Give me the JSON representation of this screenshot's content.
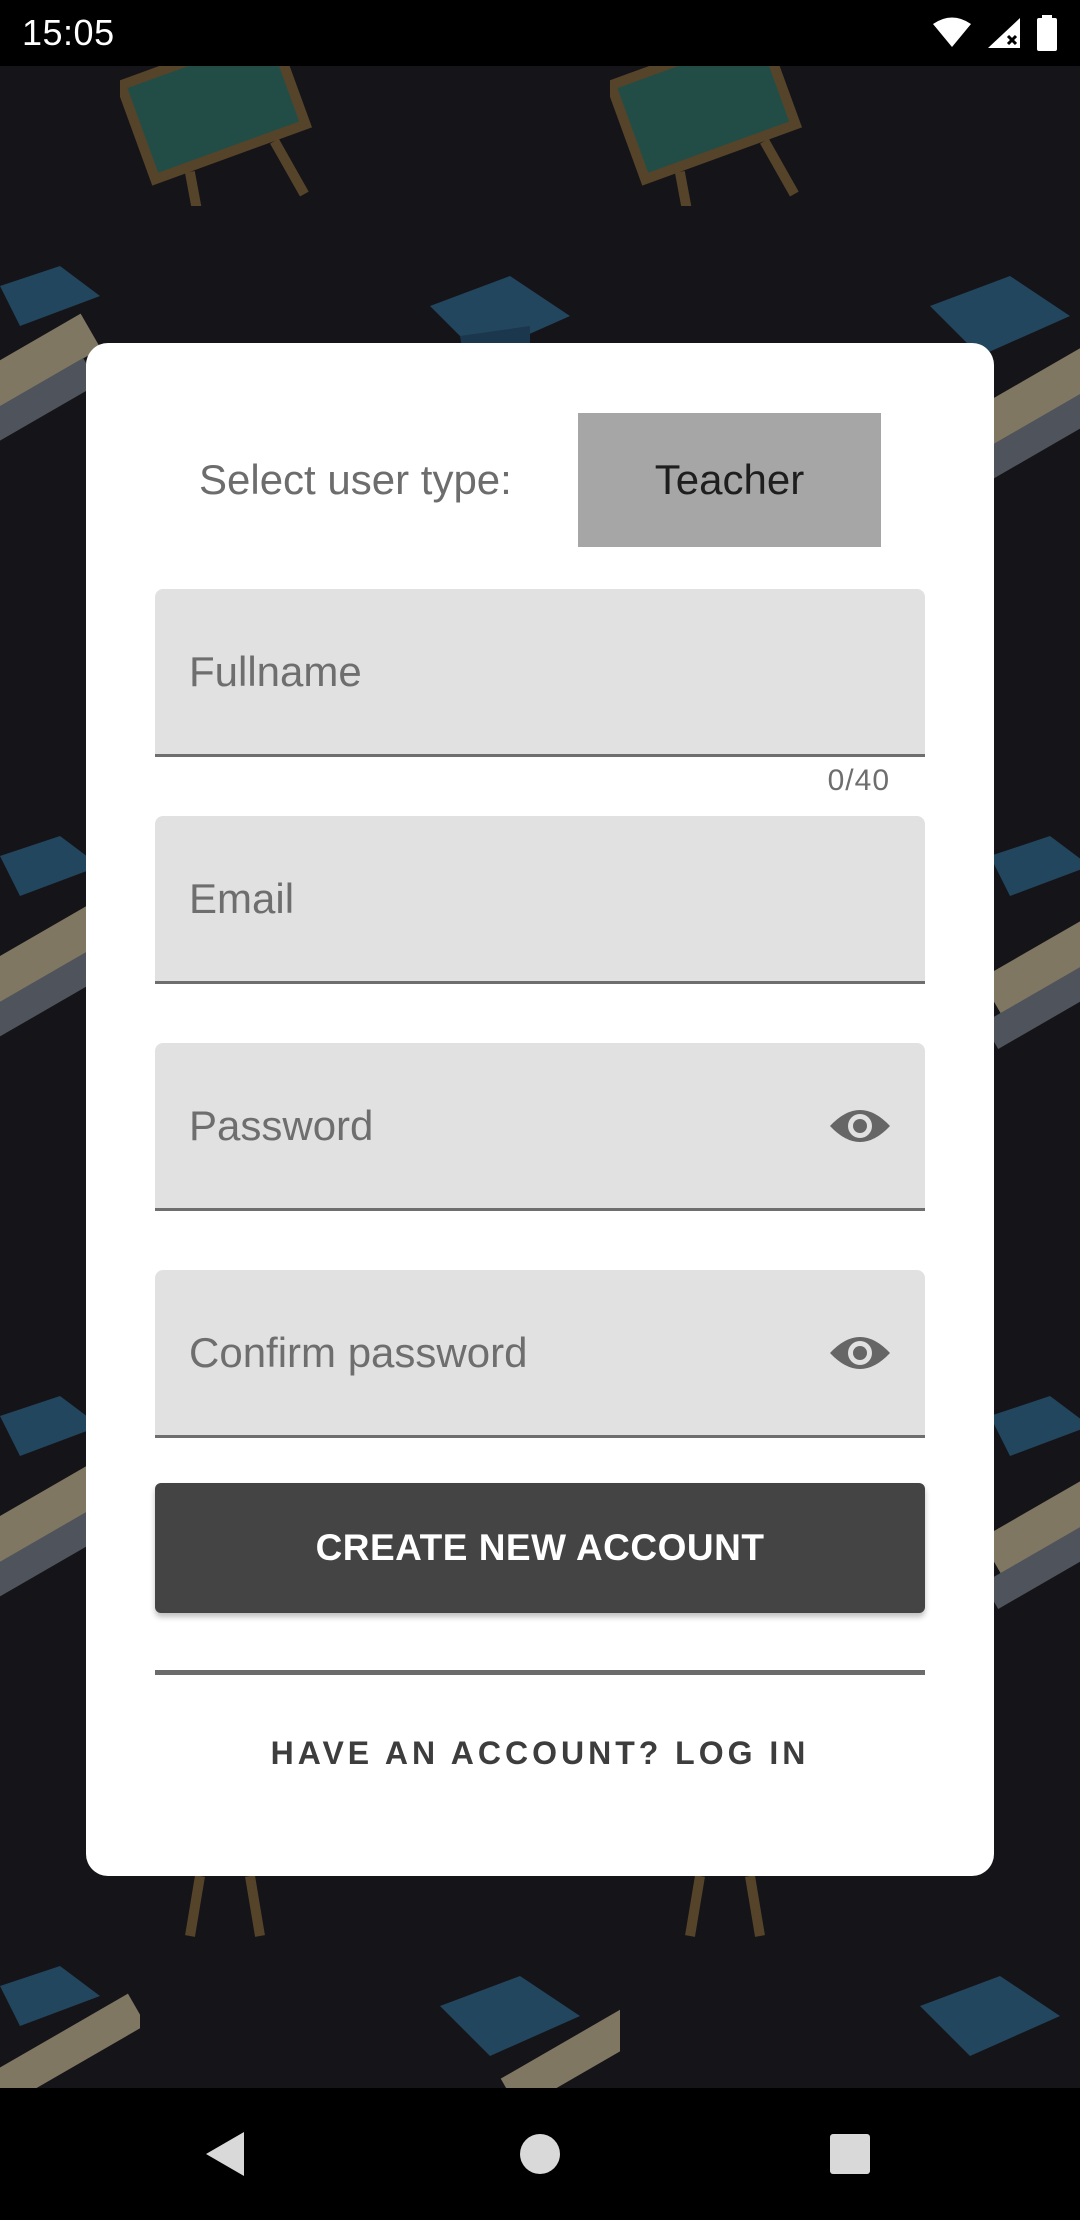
{
  "status_bar": {
    "time": "15:05",
    "icons": [
      "wifi-icon",
      "cellular-signal-icon",
      "battery-icon"
    ]
  },
  "form": {
    "user_type_label": "Select user type:",
    "user_type_selected": "Teacher",
    "fullname_placeholder": "Fullname",
    "fullname_counter": "0/40",
    "email_placeholder": "Email",
    "password_placeholder": "Password",
    "confirm_password_placeholder": "Confirm password",
    "create_button_label": "CREATE NEW ACCOUNT",
    "login_link_label": "HAVE AN ACCOUNT? LOG IN"
  },
  "nav_bar": {
    "icons": [
      "back-icon",
      "home-icon",
      "recents-icon"
    ]
  },
  "colors": {
    "background": "#151418",
    "card": "#ffffff",
    "field": "#e1e1e1",
    "selector": "#a6a6a6",
    "button": "#444444"
  }
}
